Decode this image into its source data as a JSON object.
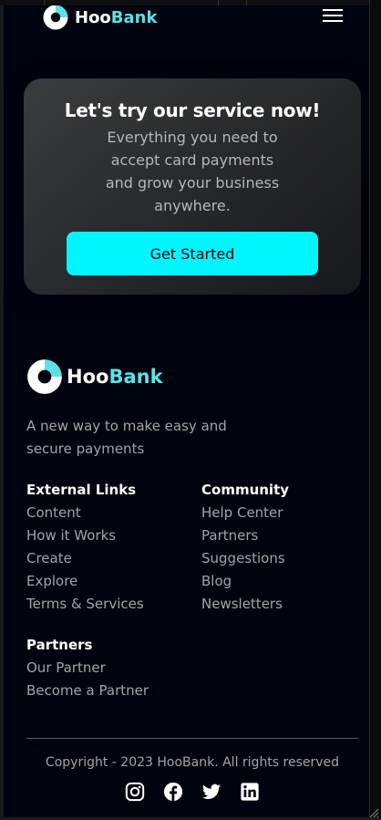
{
  "brand": {
    "name_part1": "Hoo",
    "name_part2": "Bank",
    "accent_color": "#5ce1e6"
  },
  "nav": {
    "menu_icon": "hamburger-menu-icon"
  },
  "cta": {
    "title": "Let's try our service now!",
    "text": "Everything you need to accept card payments and grow your business anywhere.",
    "button_label": "Get Started",
    "button_color": "#00f6ff"
  },
  "footer": {
    "description": "A new way to make easy and secure payments",
    "columns": [
      {
        "title": "External Links",
        "links": [
          "Content",
          "How it Works",
          "Create",
          "Explore",
          "Terms & Services"
        ]
      },
      {
        "title": "Community",
        "links": [
          "Help Center",
          "Partners",
          "Suggestions",
          "Blog",
          "Newsletters"
        ]
      },
      {
        "title": "Partners",
        "links": [
          "Our Partner",
          "Become a Partner"
        ]
      }
    ],
    "copyright": "Copyright - 2023 HooBank. All rights reserved",
    "socials": [
      "instagram-icon",
      "facebook-icon",
      "twitter-icon",
      "linkedin-icon"
    ]
  }
}
